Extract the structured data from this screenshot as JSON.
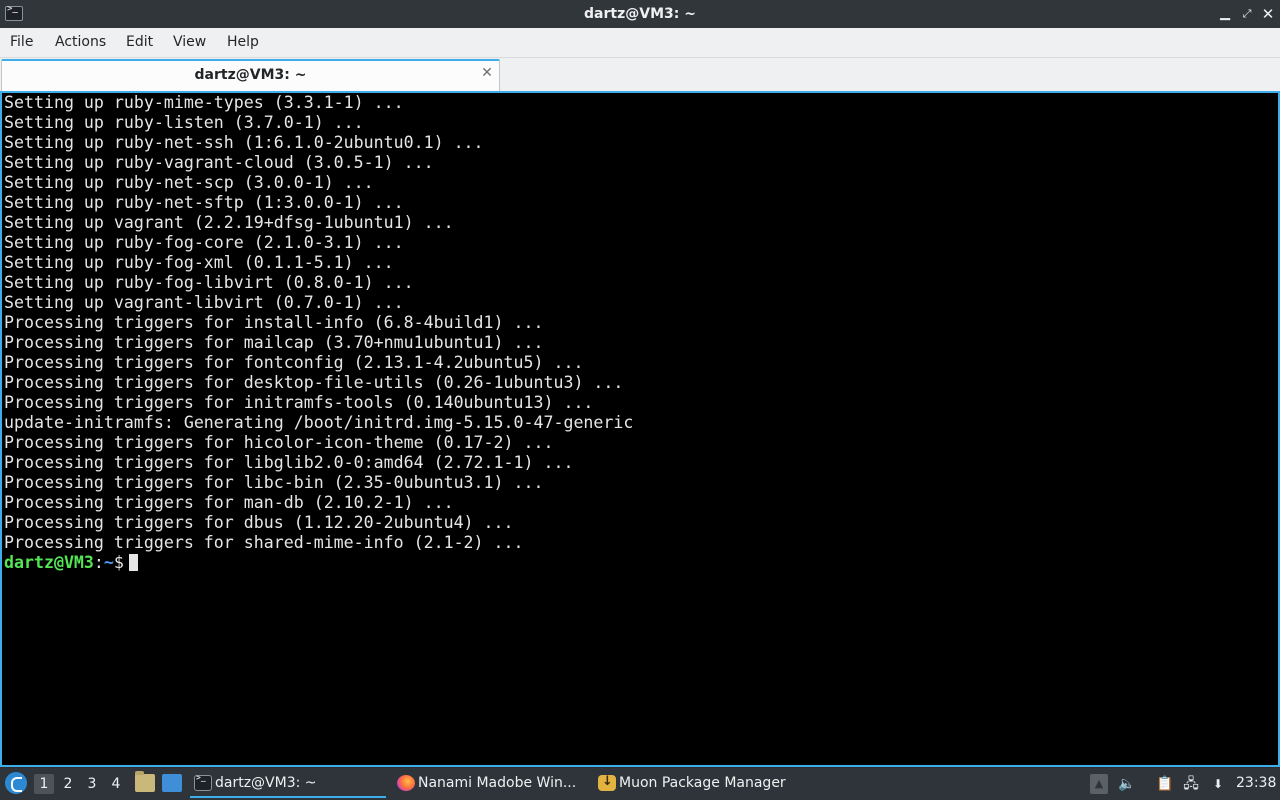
{
  "window": {
    "title": "dartz@VM3: ~",
    "icon": "terminal-icon",
    "controls": {
      "minimize": "▁",
      "maximize": "⤢",
      "close": "✕"
    }
  },
  "menu": {
    "items": [
      "File",
      "Actions",
      "Edit",
      "View",
      "Help"
    ]
  },
  "tabs": [
    {
      "label": "dartz@VM3: ~",
      "close": "✕"
    }
  ],
  "terminal": {
    "lines": [
      "Setting up ruby-mime-types (3.3.1-1) ...",
      "Setting up ruby-listen (3.7.0-1) ...",
      "Setting up ruby-net-ssh (1:6.1.0-2ubuntu0.1) ...",
      "Setting up ruby-vagrant-cloud (3.0.5-1) ...",
      "Setting up ruby-net-scp (3.0.0-1) ...",
      "Setting up ruby-net-sftp (1:3.0.0-1) ...",
      "Setting up vagrant (2.2.19+dfsg-1ubuntu1) ...",
      "Setting up ruby-fog-core (2.1.0-3.1) ...",
      "Setting up ruby-fog-xml (0.1.1-5.1) ...",
      "Setting up ruby-fog-libvirt (0.8.0-1) ...",
      "Setting up vagrant-libvirt (0.7.0-1) ...",
      "Processing triggers for install-info (6.8-4build1) ...",
      "Processing triggers for mailcap (3.70+nmu1ubuntu1) ...",
      "Processing triggers for fontconfig (2.13.1-4.2ubuntu5) ...",
      "Processing triggers for desktop-file-utils (0.26-1ubuntu3) ...",
      "Processing triggers for initramfs-tools (0.140ubuntu13) ...",
      "update-initramfs: Generating /boot/initrd.img-5.15.0-47-generic",
      "Processing triggers for hicolor-icon-theme (0.17-2) ...",
      "Processing triggers for libglib2.0-0:amd64 (2.72.1-1) ...",
      "Processing triggers for libc-bin (2.35-0ubuntu3.1) ...",
      "Processing triggers for man-db (2.10.2-1) ...",
      "Processing triggers for dbus (1.12.20-2ubuntu4) ...",
      "Processing triggers for shared-mime-info (2.1-2) ..."
    ],
    "prompt": {
      "user_host": "dartz@VM3",
      "separator": ":",
      "path": "~",
      "symbol": "$"
    },
    "colors": {
      "background": "#000000",
      "text": "#e6e6e6",
      "prompt_user": "#54e554",
      "prompt_path": "#4c9cf5",
      "border": "#3daee9"
    }
  },
  "taskbar": {
    "start_icon": "lubuntu-menu-icon",
    "workspaces": [
      "1",
      "2",
      "3",
      "4"
    ],
    "active_workspace": "1",
    "quicklaunch": [
      "file-manager-icon",
      "show-desktop-icon"
    ],
    "tasks": [
      {
        "label": "dartz@VM3: ~",
        "icon": "terminal-icon",
        "active": true
      },
      {
        "label": "Nanami Madobe Win...",
        "icon": "firefox-icon",
        "active": false
      },
      {
        "label": "Muon Package Manager",
        "icon": "muon-icon",
        "active": false
      }
    ],
    "tray": [
      "tray-expand-icon",
      "volume-icon",
      "clipboard-icon",
      "network-icon",
      "updates-icon"
    ],
    "clock": "23:38"
  }
}
